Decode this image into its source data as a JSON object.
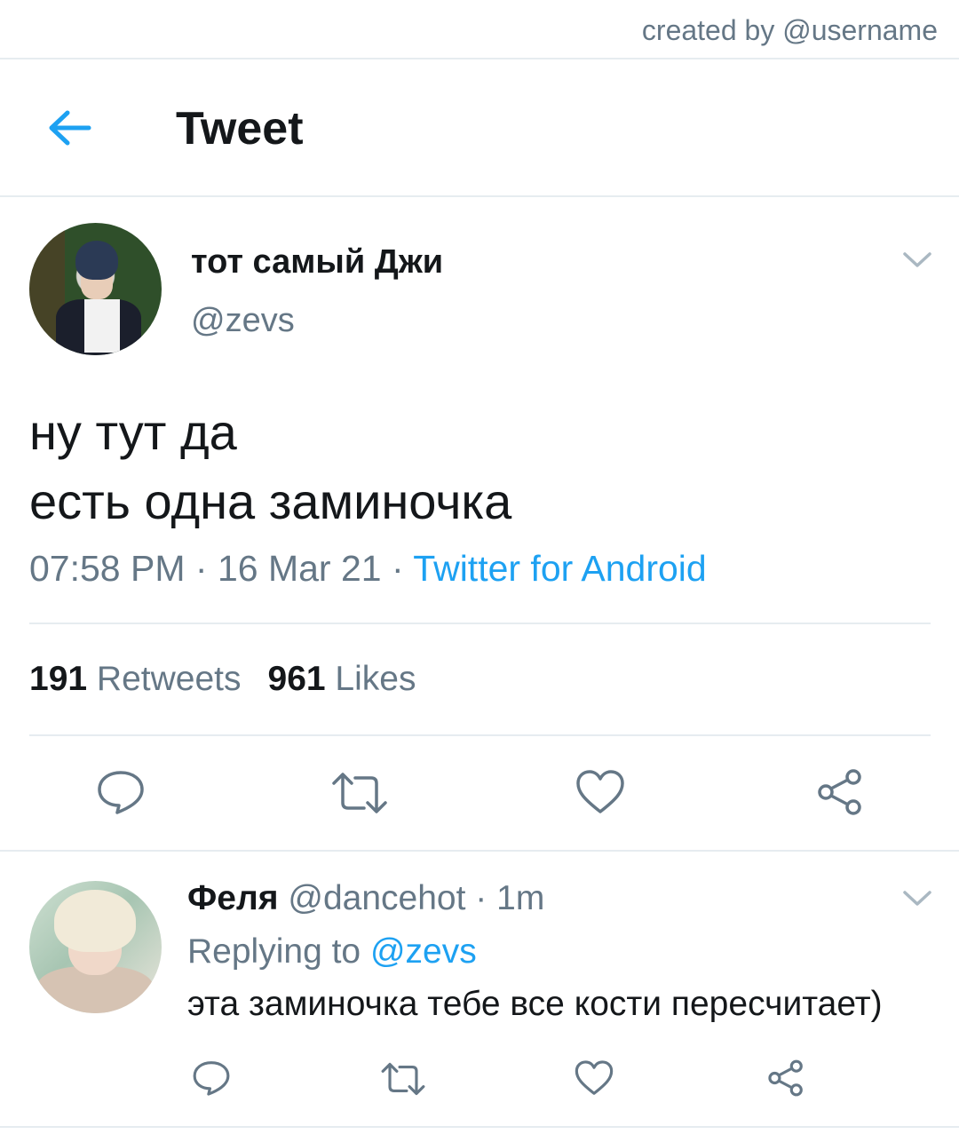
{
  "watermark": "created by @username",
  "header": {
    "title": "Tweet",
    "back_icon": "arrow-left-icon"
  },
  "colors": {
    "accent": "#1da1f2",
    "secondary_text": "#657786",
    "primary_text": "#14171a",
    "divider": "#e6ecf0"
  },
  "tweet": {
    "display_name": "тот самый Джи",
    "handle": "@zevs",
    "text_lines": [
      "ну тут да",
      "есть одна заминочка"
    ],
    "time": "07:58 PM",
    "sep": "·",
    "date": "16 Mar 21",
    "source": "Twitter for Android",
    "retweets_count": "191",
    "retweets_label": "Retweets",
    "likes_count": "961",
    "likes_label": "Likes"
  },
  "reply": {
    "display_name": "Феля",
    "handle": "@dancehot",
    "sep": "·",
    "time": "1m",
    "replying_label": "Replying to",
    "replying_to": "@zevs",
    "text": "эта заминочка тебе все кости пересчитает)"
  }
}
